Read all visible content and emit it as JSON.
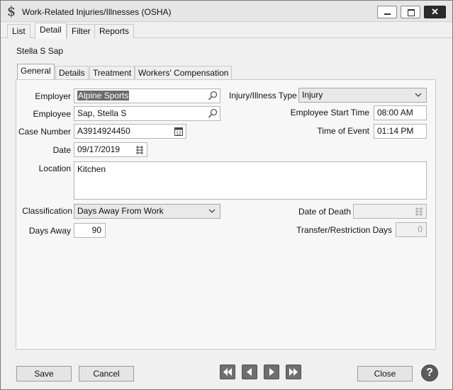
{
  "window": {
    "title": "Work-Related Injuries/Illnesses (OSHA)",
    "icon": "dollar-sign-icon",
    "close_glyph": "✕"
  },
  "top_tabs": [
    {
      "label": "List"
    },
    {
      "label": "Detail"
    },
    {
      "label": "Filter"
    },
    {
      "label": "Reports"
    }
  ],
  "active_top_tab": "Detail",
  "person": "Stella S Sap",
  "sub_tabs": [
    {
      "label": "General"
    },
    {
      "label": "Details"
    },
    {
      "label": "Treatment"
    },
    {
      "label": "Workers' Compensation"
    }
  ],
  "active_sub_tab": "General",
  "form": {
    "employer_label": "Employer",
    "employer_value": "Alpine Sports",
    "employee_label": "Employee",
    "employee_value": "Sap, Stella S",
    "case_number_label": "Case Number",
    "case_number_value": "A3914924450",
    "date_label": "Date",
    "date_value": "09/17/2019",
    "location_label": "Location",
    "location_value": "Kitchen",
    "classification_label": "Classification",
    "classification_value": "Days Away From Work",
    "days_away_label": "Days Away",
    "days_away_value": "90",
    "injury_type_label": "Injury/Illness Type",
    "injury_type_value": "Injury",
    "employee_start_label": "Employee Start Time",
    "employee_start_value": "08:00 AM",
    "time_of_event_label": "Time of Event",
    "time_of_event_value": "01:14 PM",
    "date_of_death_label": "Date of Death",
    "date_of_death_value": "",
    "transfer_days_label": "Transfer/Restriction Days",
    "transfer_days_value": "0"
  },
  "buttons": {
    "save": "Save",
    "cancel": "Cancel",
    "close": "Close",
    "help": "?"
  },
  "nav_icons": [
    "first-record-icon",
    "previous-record-icon",
    "next-record-icon",
    "last-record-icon"
  ],
  "colors": {
    "selection": "#6b6b6b",
    "nav_button": "#6f6f6f",
    "close_button": "#2a2a2a"
  }
}
